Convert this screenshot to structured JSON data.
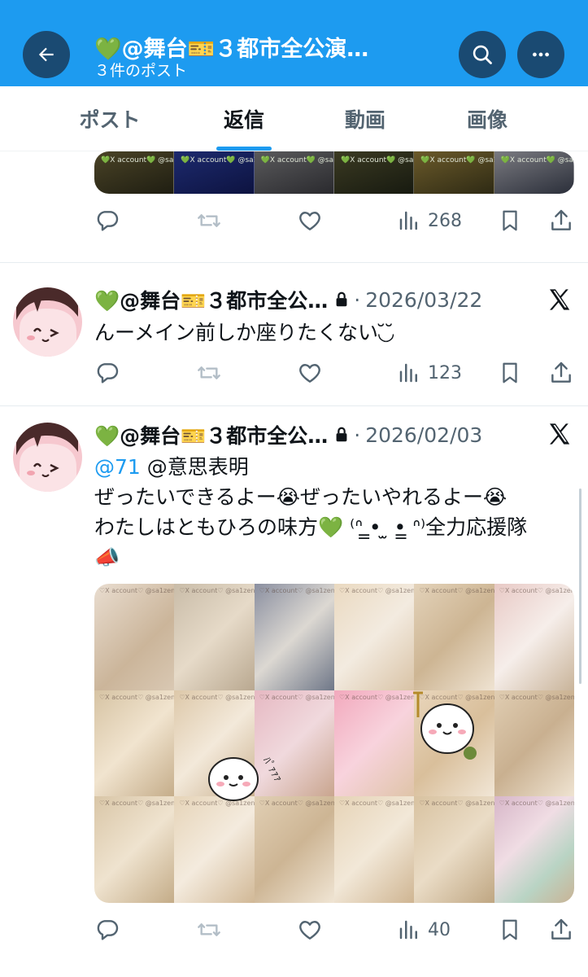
{
  "header": {
    "title": "💚@舞台🎫３都市全公演…",
    "subtitle": "３件のポスト"
  },
  "tabs": [
    {
      "label": "ポスト"
    },
    {
      "label": "返信"
    },
    {
      "label": "動画"
    },
    {
      "label": "画像"
    }
  ],
  "icons": {
    "back": "arrow-left-icon",
    "search": "search-icon",
    "more": "more-horizontal-icon",
    "reply": "comment-icon",
    "retweet": "retweet-icon",
    "like": "heart-icon",
    "views": "bar-chart-icon",
    "bookmark": "bookmark-icon",
    "share": "share-icon",
    "lock": "lock-icon",
    "xlogo": "x-logo-icon"
  },
  "colors": {
    "accent": "#1d9bf0",
    "header_btn": "#1a4a72",
    "muted": "#536471"
  },
  "posts": [
    {
      "media_watermark": "💚X account💚 @sa1zensuwaru",
      "views": "268"
    },
    {
      "name": "💚@舞台🎫３都市全公…",
      "date": "2026/03/22",
      "text": "んーメイン前しか座りたくない◟̆◞̆ ",
      "views": "123"
    },
    {
      "name": "💚@舞台🎫３都市全公…",
      "date": "2026/02/03",
      "mention": "@71",
      "mention_rest": " @意思表明",
      "line1": "ぜったいできるよー😭ぜったいやれるよー😭",
      "line2": "わたしはともひろの味方💚 ⁽ᐢ ̳• ̫ •̳ ᐢ⁾全力応援隊",
      "line3": "📣",
      "media_watermark": "♡X account♡ @sa1zensuwaru",
      "sticker_text": "ﾊﾟｧｧｧ",
      "views": "40"
    }
  ]
}
